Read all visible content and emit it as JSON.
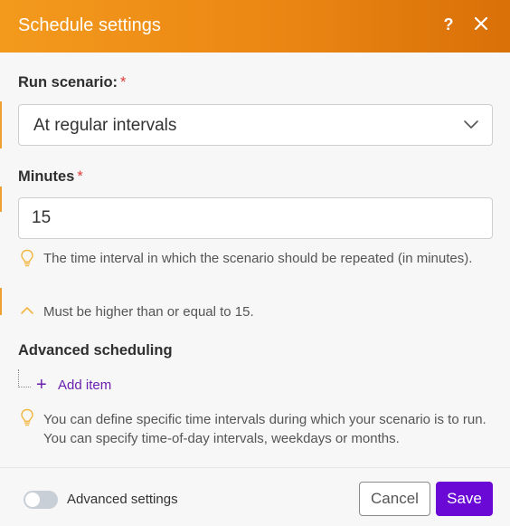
{
  "dialog": {
    "title": "Schedule settings",
    "help_label": "?"
  },
  "run_scenario": {
    "label": "Run scenario:",
    "required_mark": "*",
    "selected": "At regular intervals"
  },
  "minutes": {
    "label": "Minutes",
    "required_mark": "*",
    "value": "15",
    "hint": "The time interval in which the scenario should be repeated (in minutes).",
    "validation": "Must be higher than or equal to 15."
  },
  "advanced_scheduling": {
    "label": "Advanced scheduling",
    "add_item_label": "Add item",
    "hint": "You can define specific time intervals during which your scenario is to run. You can specify time-of-day intervals, weekdays or months."
  },
  "footer": {
    "advanced_settings_label": "Advanced settings",
    "advanced_settings_on": false,
    "cancel_label": "Cancel",
    "save_label": "Save"
  },
  "colors": {
    "header_start": "#f39a1d",
    "header_end": "#d97008",
    "primary": "#6a09d6",
    "link": "#6a1fb0",
    "required": "#e03a3a",
    "hint_icon": "#f2b640"
  },
  "icons": {
    "help": "help-icon",
    "close": "close-icon",
    "dropdown": "chevron-down-icon",
    "hint": "lightbulb-icon",
    "collapse": "chevron-up-icon",
    "add": "plus-icon"
  }
}
